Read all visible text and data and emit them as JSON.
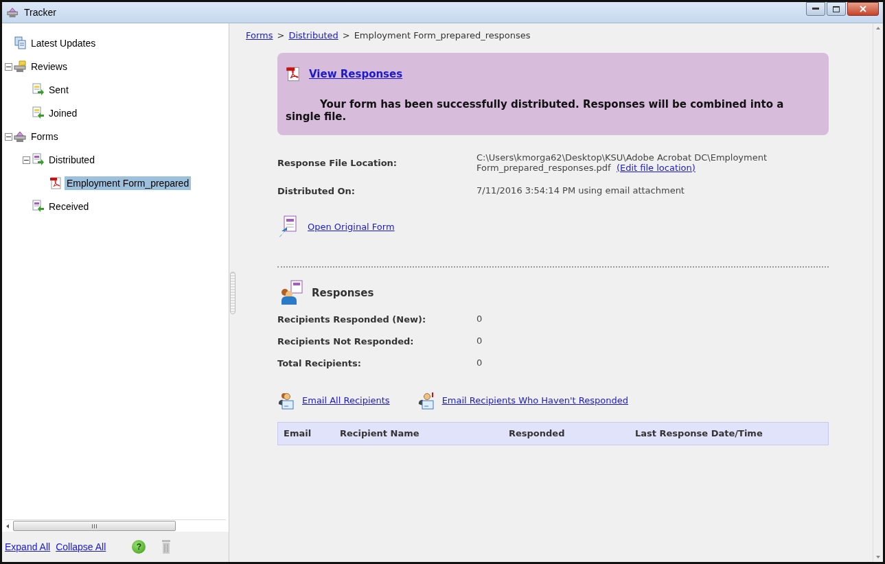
{
  "window": {
    "title": "Tracker"
  },
  "tree": [
    {
      "label": "Latest Updates",
      "kind": "updates",
      "selected": false
    },
    {
      "label": "Reviews",
      "kind": "reviews",
      "selected": false,
      "expanded": true,
      "children": [
        {
          "label": "Sent",
          "kind": "sent",
          "selected": false
        },
        {
          "label": "Joined",
          "kind": "joined",
          "selected": false
        }
      ]
    },
    {
      "label": "Forms",
      "kind": "forms",
      "selected": false,
      "expanded": true,
      "children": [
        {
          "label": "Distributed",
          "kind": "distributed",
          "selected": false,
          "expanded": true,
          "children": [
            {
              "label": "Employment Form_prepared",
              "kind": "pdf",
              "selected": true
            }
          ]
        },
        {
          "label": "Received",
          "kind": "received",
          "selected": false
        }
      ]
    }
  ],
  "sidebar_footer": {
    "links": [
      "Expand All",
      "Collapse All"
    ],
    "help_glyph": "?"
  },
  "breadcrumb": {
    "links": [
      "Forms",
      "Distributed"
    ],
    "separator": ">",
    "current": "Employment Form_prepared_responses"
  },
  "banner": {
    "link": "View Responses",
    "message": "Your form has been successfully distributed. Responses will be combined into a single file."
  },
  "details": [
    {
      "label": "Response File Location:",
      "value_lines": [
        "C:\\Users\\kmorga62\\Desktop\\KSU\\Adobe Acrobat DC\\Employment",
        "Form_prepared_responses.pdf"
      ],
      "link": "(Edit file location)"
    },
    {
      "label": "Distributed On:",
      "value_lines": [
        "7/11/2016 3:54:14 PM using email attachment"
      ]
    }
  ],
  "open_original_form": "Open Original Form",
  "responses": {
    "title": "Responses",
    "rows": [
      {
        "label": "Recipients Responded (New):",
        "value": "0"
      },
      {
        "label": "Recipients Not Responded:",
        "value": "0"
      },
      {
        "label": "Total Recipients:",
        "value": "0"
      }
    ]
  },
  "email_links": [
    {
      "label": "Email All Recipients",
      "kind": "all"
    },
    {
      "label": "Email Recipients Who Haven't Responded",
      "kind": "pending"
    }
  ],
  "table": {
    "columns": [
      "Email",
      "Recipient Name",
      "Responded",
      "Last Response Date/Time"
    ]
  }
}
